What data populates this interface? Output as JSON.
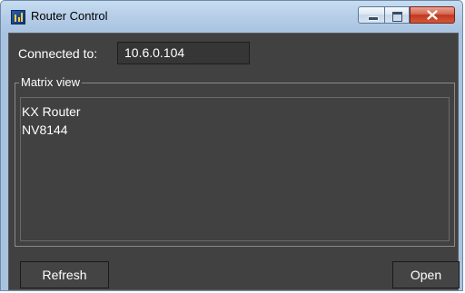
{
  "window": {
    "title": "Router Control",
    "icon": "app-icon",
    "controls": [
      "minimize-icon",
      "maximize-icon",
      "close-icon"
    ]
  },
  "connection": {
    "label": "Connected to:",
    "value": "10.6.0.104"
  },
  "matrix": {
    "legend": "Matrix view",
    "items": [
      {
        "label": "KX Router"
      },
      {
        "label": "NV8144"
      }
    ]
  },
  "buttons": {
    "refresh": "Refresh",
    "open": "Open"
  },
  "colors": {
    "panel_background": "#414141",
    "text": "#ffffff",
    "close_button": "#c1391e"
  }
}
